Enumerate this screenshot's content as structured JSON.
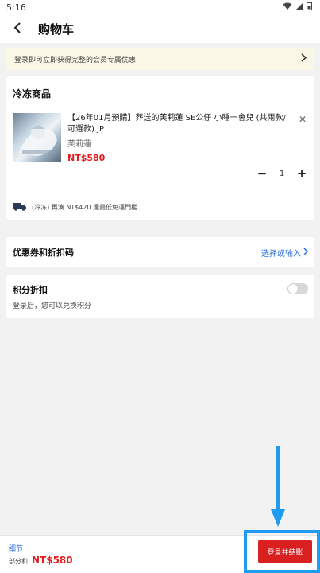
{
  "status_bar": {
    "time": "5:16"
  },
  "header": {
    "title": "购物车"
  },
  "login_banner": {
    "text": "登录即可立即获得完整的会员专属优惠"
  },
  "frozen_section": {
    "title": "冷冻商品",
    "product": {
      "title": "【26年01月預購】葬送的芙莉蓮 SE公仔 小睡一會兒 (共兩款/可選款) JP",
      "brand": "芙莉蓮",
      "price": "NT$580",
      "quantity": "1"
    },
    "shipping_note": "(冷冻) 再湊 NT$420 達最低免運門檻"
  },
  "coupon": {
    "label": "优惠券和折扣码",
    "action": "选择或输入"
  },
  "points": {
    "title": "积分折扣",
    "hint": "登录后，您可以兑换积分",
    "toggle_on": false
  },
  "bottom_bar": {
    "details_label": "细节",
    "subtotal_label": "部分和",
    "subtotal_amount": "NT$580",
    "checkout_label": "登录并结账"
  },
  "colors": {
    "accent_blue": "#2a6fdb",
    "price_red": "#e02020",
    "checkout_red": "#d91f1f",
    "highlight_blue": "#1f9bf0"
  },
  "icons": [
    "back-arrow-icon",
    "chevron-right-icon",
    "close-icon",
    "minus-icon",
    "plus-icon",
    "truck-icon",
    "wifi-icon",
    "signal-icon",
    "battery-icon"
  ]
}
